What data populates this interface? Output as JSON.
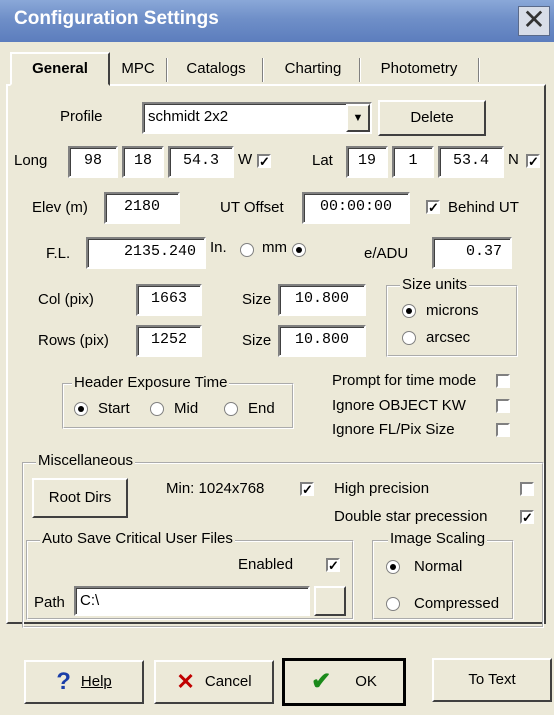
{
  "window": {
    "title": "Configuration Settings",
    "close_glyph": "✕"
  },
  "tabs": [
    {
      "label": "General",
      "active": true
    },
    {
      "label": "MPC"
    },
    {
      "label": "Catalogs"
    },
    {
      "label": "Charting"
    },
    {
      "label": "Photometry"
    }
  ],
  "profile": {
    "label": "Profile",
    "value": "schmidt 2x2",
    "delete_label": "Delete",
    "dropdown_glyph": "▼"
  },
  "long": {
    "label": "Long",
    "deg": "98",
    "min": "18",
    "sec": "54.3",
    "dir": "W",
    "checked": "✓"
  },
  "lat": {
    "label": "Lat",
    "deg": "19",
    "min": "1",
    "sec": "53.4",
    "dir": "N",
    "checked": "✓"
  },
  "elev": {
    "label": "Elev (m)",
    "value": "2180"
  },
  "ut_offset": {
    "label": "UT Offset",
    "value": "00:00:00",
    "behind_label": "Behind UT",
    "behind_checked": "✓"
  },
  "fl": {
    "label": "F.L.",
    "value": "2135.240",
    "in_label": "In.",
    "mm_label": "mm"
  },
  "eadu": {
    "label": "e/ADU",
    "value": "0.37"
  },
  "col": {
    "label": "Col (pix)",
    "value": "1663",
    "size_label": "Size",
    "size_value": "10.800"
  },
  "rows": {
    "label": "Rows (pix)",
    "value": "1252",
    "size_label": "Size",
    "size_value": "10.800"
  },
  "size_units": {
    "title": "Size units",
    "microns": "microns",
    "arcsec": "arcsec"
  },
  "header_exposure": {
    "title": "Header Exposure Time",
    "start": "Start",
    "mid": "Mid",
    "end": "End"
  },
  "options": {
    "prompt_time_mode": "Prompt for time mode",
    "ignore_object": "Ignore OBJECT KW",
    "ignore_fl": "Ignore FL/Pix Size"
  },
  "misc": {
    "title": "Miscellaneous",
    "root_dirs": "Root Dirs",
    "min_res": "Min: 1024x768",
    "min_res_checked": "✓",
    "high_precision": "High precision",
    "double_star": "Double star precession",
    "double_star_checked": "✓"
  },
  "autosave": {
    "title": "Auto Save Critical User Files",
    "enabled_label": "Enabled",
    "enabled_checked": "✓",
    "path_label": "Path",
    "path_value": "C:\\"
  },
  "image_scaling": {
    "title": "Image Scaling",
    "normal": "Normal",
    "compressed": "Compressed"
  },
  "buttons": {
    "help": "Help",
    "help_glyph": "?",
    "cancel": "Cancel",
    "cancel_glyph": "✕",
    "ok": "OK",
    "ok_glyph": "✔",
    "to_text": "To Text"
  },
  "colors": {
    "title_bar": "#7090c8",
    "dialog_bg": "#ece9d8",
    "help_icon": "#1a3ea8",
    "cancel_icon": "#c00000",
    "ok_icon": "#1a8a1a"
  }
}
